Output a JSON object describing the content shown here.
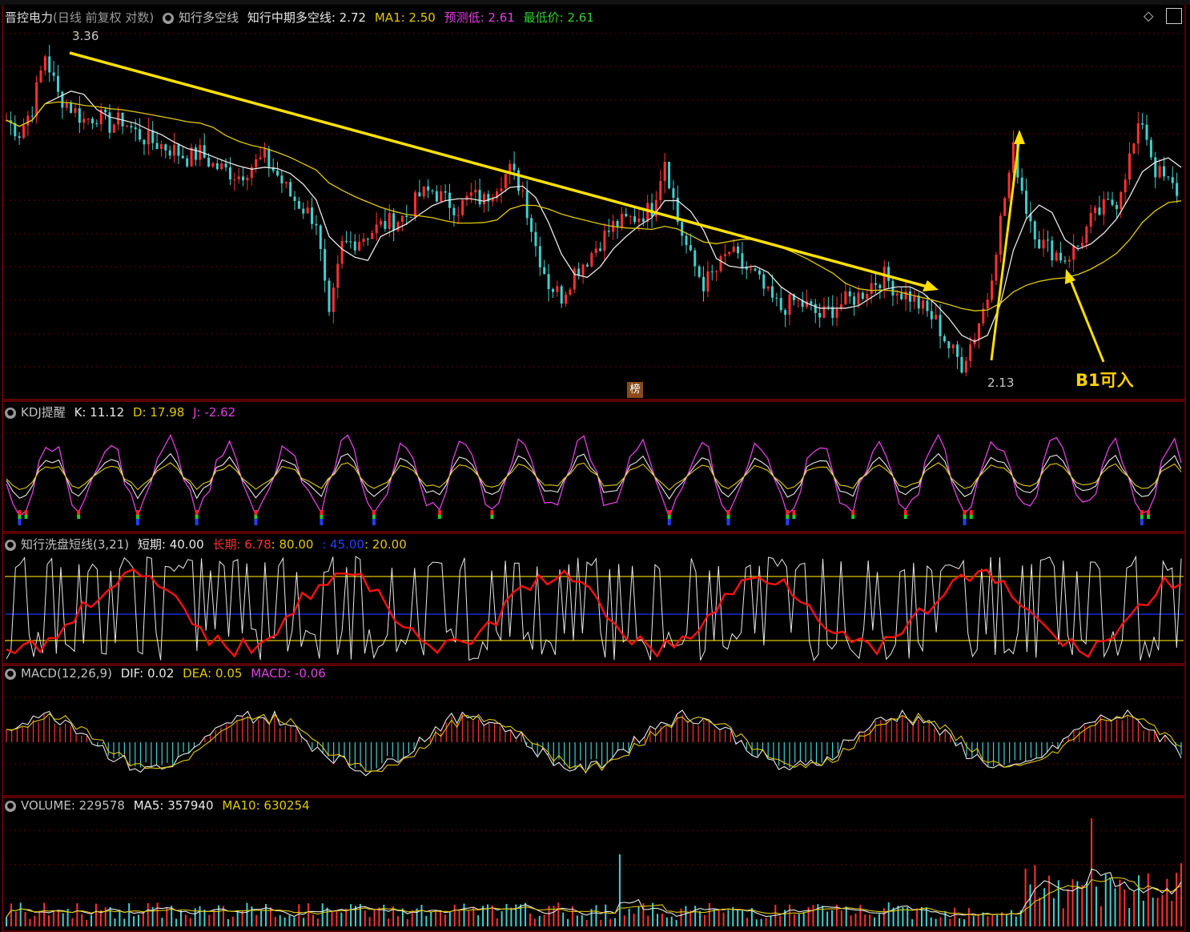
{
  "price": {
    "stock": "晋控电力",
    "mode": "(日线 前复权 对数)",
    "indicator": "知行多空线",
    "mid_label": "知行中期多空线: 2.72",
    "ma1_label": "MA1: 2.50",
    "pred_label": "预测低: 2.61",
    "low_label": "最低价: 2.61",
    "high_mark": "3.36",
    "low_mark": "2.13",
    "rank_badge": "榜",
    "note": "B1可入"
  },
  "kdj": {
    "name": "KDJ提醒",
    "k": "K: 11.12",
    "d": "D: 17.98",
    "j": "J: -2.62"
  },
  "wash": {
    "name": "知行洗盘短线(3,21)",
    "short": "短期: 40.00",
    "long": "长期: 6.78",
    "l80": ": 80.00",
    "l45": ": 45.00",
    "l20": ": 20.00"
  },
  "macd": {
    "name": "MACD(12,26,9)",
    "dif": "DIF: 0.02",
    "dea": "DEA: 0.05",
    "macd": "MACD: -0.06"
  },
  "volume": {
    "name": "VOLUME: 229578",
    "ma5": "MA5: 357940",
    "ma10": "MA10: 630254"
  },
  "colors": {
    "up": "#ff3030",
    "down": "#40d0d0",
    "white": "#e8e8e8",
    "yellow": "#e0c800",
    "magenta": "#e040e0",
    "frame": "#b00000",
    "arrow": "#ffe000"
  },
  "chart_data": {
    "type": "candlestick",
    "price_range": [
      2.13,
      3.36
    ],
    "close": [
      3.1,
      3.05,
      3.15,
      3.36,
      3.2,
      3.15,
      3.1,
      3.12,
      3.08,
      3.1,
      3.05,
      3.02,
      3.0,
      2.98,
      2.95,
      2.97,
      2.92,
      2.9,
      2.88,
      2.92,
      2.95,
      2.88,
      2.8,
      2.75,
      2.7,
      2.3,
      2.6,
      2.62,
      2.65,
      2.68,
      2.7,
      2.72,
      2.8,
      2.82,
      2.78,
      2.75,
      2.8,
      2.78,
      2.85,
      2.9,
      2.82,
      2.6,
      2.45,
      2.4,
      2.5,
      2.55,
      2.62,
      2.68,
      2.7,
      2.72,
      2.75,
      2.95,
      2.7,
      2.55,
      2.45,
      2.5,
      2.58,
      2.52,
      2.48,
      2.4,
      2.35,
      2.38,
      2.36,
      2.32,
      2.35,
      2.38,
      2.4,
      2.45,
      2.48,
      2.42,
      2.4,
      2.35,
      2.3,
      2.2,
      2.13,
      2.25,
      2.4,
      2.7,
      2.98,
      2.75,
      2.62,
      2.58,
      2.55,
      2.6,
      2.7,
      2.75,
      2.78,
      2.95,
      3.1,
      2.9,
      2.85,
      2.8
    ]
  }
}
